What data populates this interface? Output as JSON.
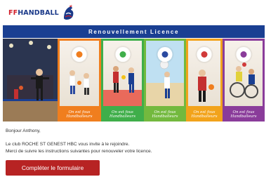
{
  "logo": {
    "part1": "FF",
    "part2": "HANDBALL"
  },
  "banner": {
    "title": "Renouvellement Licence"
  },
  "panels": [
    {
      "tagline": ""
    },
    {
      "tagline": "On est fous Handballeurs"
    },
    {
      "tagline": "On est fous Handballeurs"
    },
    {
      "tagline": "On est fous Handballeurs"
    },
    {
      "tagline": "On est fous Handballeurs"
    },
    {
      "tagline": "On est fous Handballeurs"
    }
  ],
  "message": {
    "greeting": "Bonjour Anthony,",
    "line1": "Le club ROCHE ST GENEST HBC vous invite à le rejoindre.",
    "line2": "Merci de suivre les instructions suivantes pour renouveler votre licence."
  },
  "cta": {
    "label": "Compléter le formulaire"
  },
  "colors": {
    "brand_blue": "#1a3f92",
    "brand_red": "#d11f2b",
    "button_red": "#b72323"
  }
}
